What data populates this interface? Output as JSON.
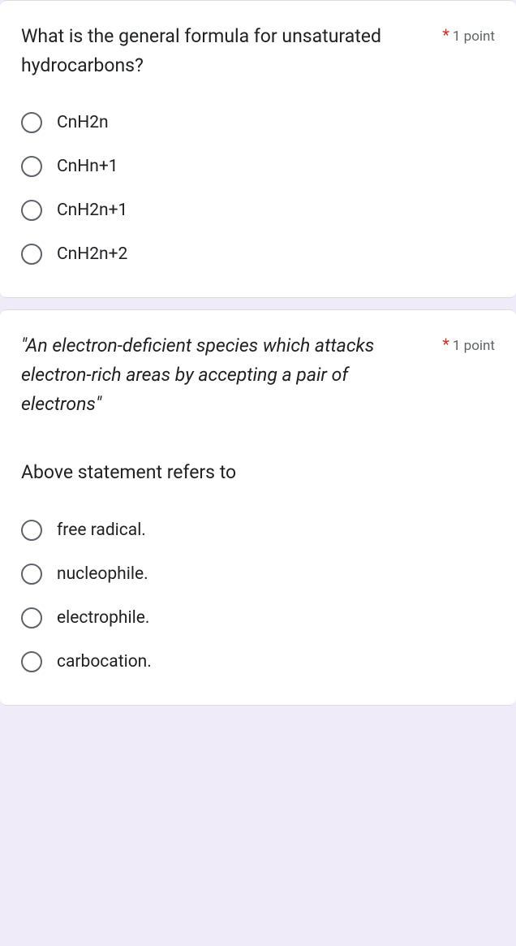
{
  "questions": [
    {
      "title": "What is the general formula for unsaturated hydrocarbons?",
      "title_italic": false,
      "points_label": "1 point",
      "subtext": null,
      "options": [
        "CnH2n",
        "CnHn+1",
        "CnH2n+1",
        "CnH2n+2"
      ]
    },
    {
      "title": "\"An electron-deficient species which attacks electron-rich areas by accepting a pair of electrons\"",
      "title_italic": true,
      "points_label": "1 point",
      "subtext": "Above statement refers to",
      "options": [
        "free radical.",
        "nucleophile.",
        "electrophile.",
        "carbocation."
      ]
    }
  ],
  "required_star": "*"
}
